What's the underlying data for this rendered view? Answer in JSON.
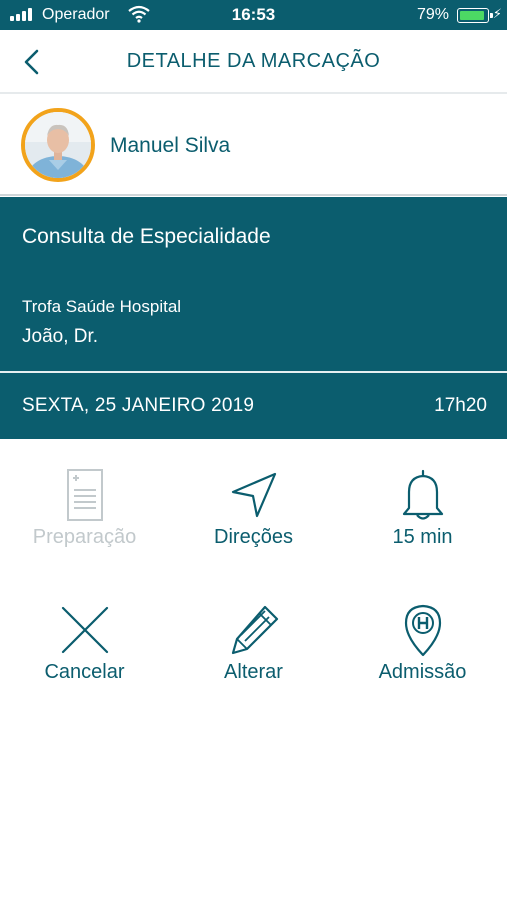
{
  "status_bar": {
    "carrier": "Operador",
    "time": "16:53",
    "battery": "79%",
    "battery_level": 0.79
  },
  "nav": {
    "title": "DETALHE DA MARCAÇÃO",
    "back_icon": "chevron-left-icon"
  },
  "profile": {
    "name": "Manuel Silva",
    "avatar_border_color": "#f2a31b"
  },
  "appointment": {
    "type": "Consulta de Especialidade",
    "hospital": "Trofa Saúde Hospital",
    "doctor": "João, Dr.",
    "date": "SEXTA, 25 JANEIRO 2019",
    "time": "17h20",
    "background_color": "#0b5d6e"
  },
  "actions": [
    {
      "label": "Preparação",
      "icon": "document-icon",
      "enabled": false
    },
    {
      "label": "Direções",
      "icon": "navigation-arrow-icon",
      "enabled": true
    },
    {
      "label": "15 min",
      "icon": "bell-icon",
      "enabled": true
    },
    {
      "label": "Cancelar",
      "icon": "close-icon",
      "enabled": true
    },
    {
      "label": "Alterar",
      "icon": "pencil-icon",
      "enabled": true
    },
    {
      "label": "Admissão",
      "icon": "hospital-pin-icon",
      "enabled": true
    }
  ]
}
